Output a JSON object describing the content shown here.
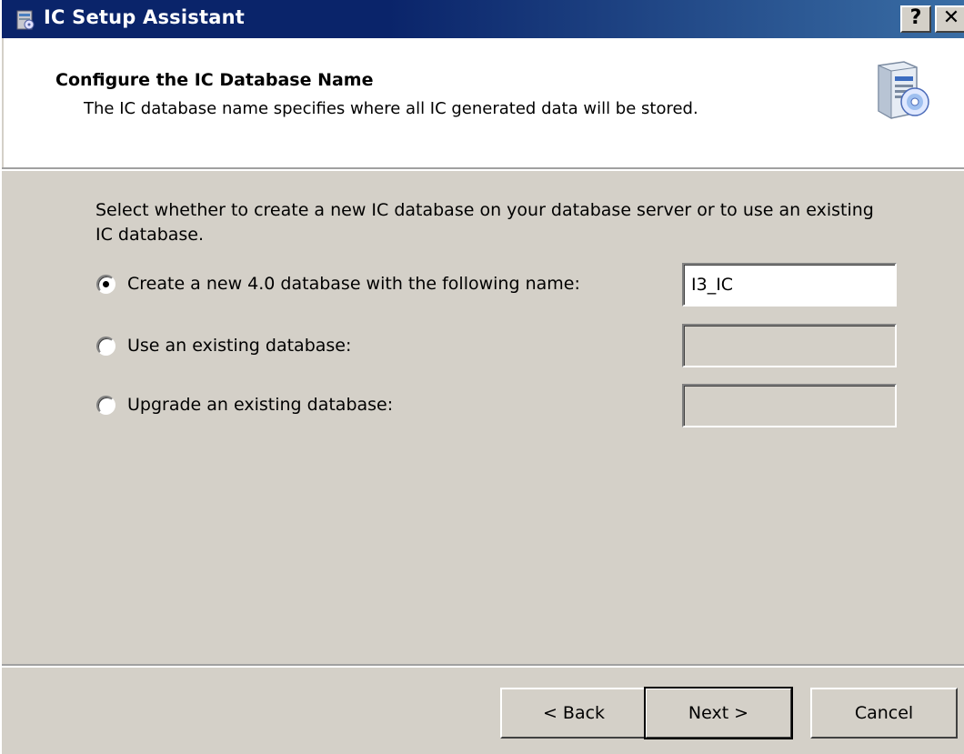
{
  "window": {
    "title": "IC Setup Assistant",
    "help_label": "?",
    "close_label": "✕"
  },
  "header": {
    "title": "Configure the IC Database Name",
    "subtitle": "The IC database name specifies where all IC generated data will be stored.",
    "icon": "server-cd-icon"
  },
  "body": {
    "instructions": "Select whether to create a new IC database on your database server or to use an existing IC database.",
    "options": [
      {
        "label": "Create a new 4.0 database with the following name:",
        "selected": true,
        "value": "I3_IC",
        "enabled": true
      },
      {
        "label": "Use an existing database:",
        "selected": false,
        "value": "",
        "enabled": false
      },
      {
        "label": "Upgrade an existing database:",
        "selected": false,
        "value": "",
        "enabled": false
      }
    ]
  },
  "buttons": {
    "back": "< Back",
    "next": "Next >",
    "cancel": "Cancel"
  },
  "colors": {
    "titlebar": "#0a246a",
    "face": "#d4d0c8",
    "header_bg": "#ffffff"
  }
}
